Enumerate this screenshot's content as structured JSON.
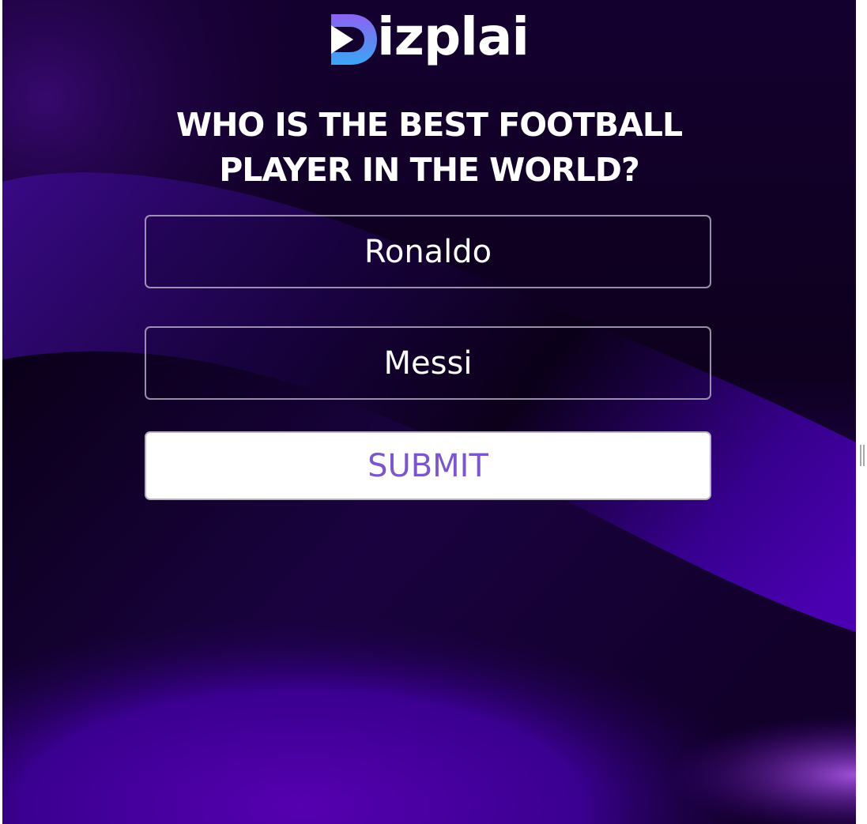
{
  "brand": {
    "name": "Dizplai",
    "logo_wordmark": "izplai",
    "logo_icon": "play-d-icon",
    "colors": {
      "icon_gradient_top": "#8e62f2",
      "icon_gradient_bottom": "#39a6f5",
      "play_triangle": "#ffffff"
    }
  },
  "poll": {
    "question": "WHO IS THE BEST FOOTBALL PLAYER IN THE WORLD?",
    "options": [
      {
        "label": "Ronaldo"
      },
      {
        "label": "Messi"
      }
    ],
    "submit_label": "SUBMIT"
  },
  "theme": {
    "background_dark": "#12002e",
    "background_purple": "#4a00a6",
    "text": "#ffffff",
    "submit_text": "#7b57c9"
  },
  "window": {
    "resize_handle_icon": "resize-grip-icon"
  }
}
